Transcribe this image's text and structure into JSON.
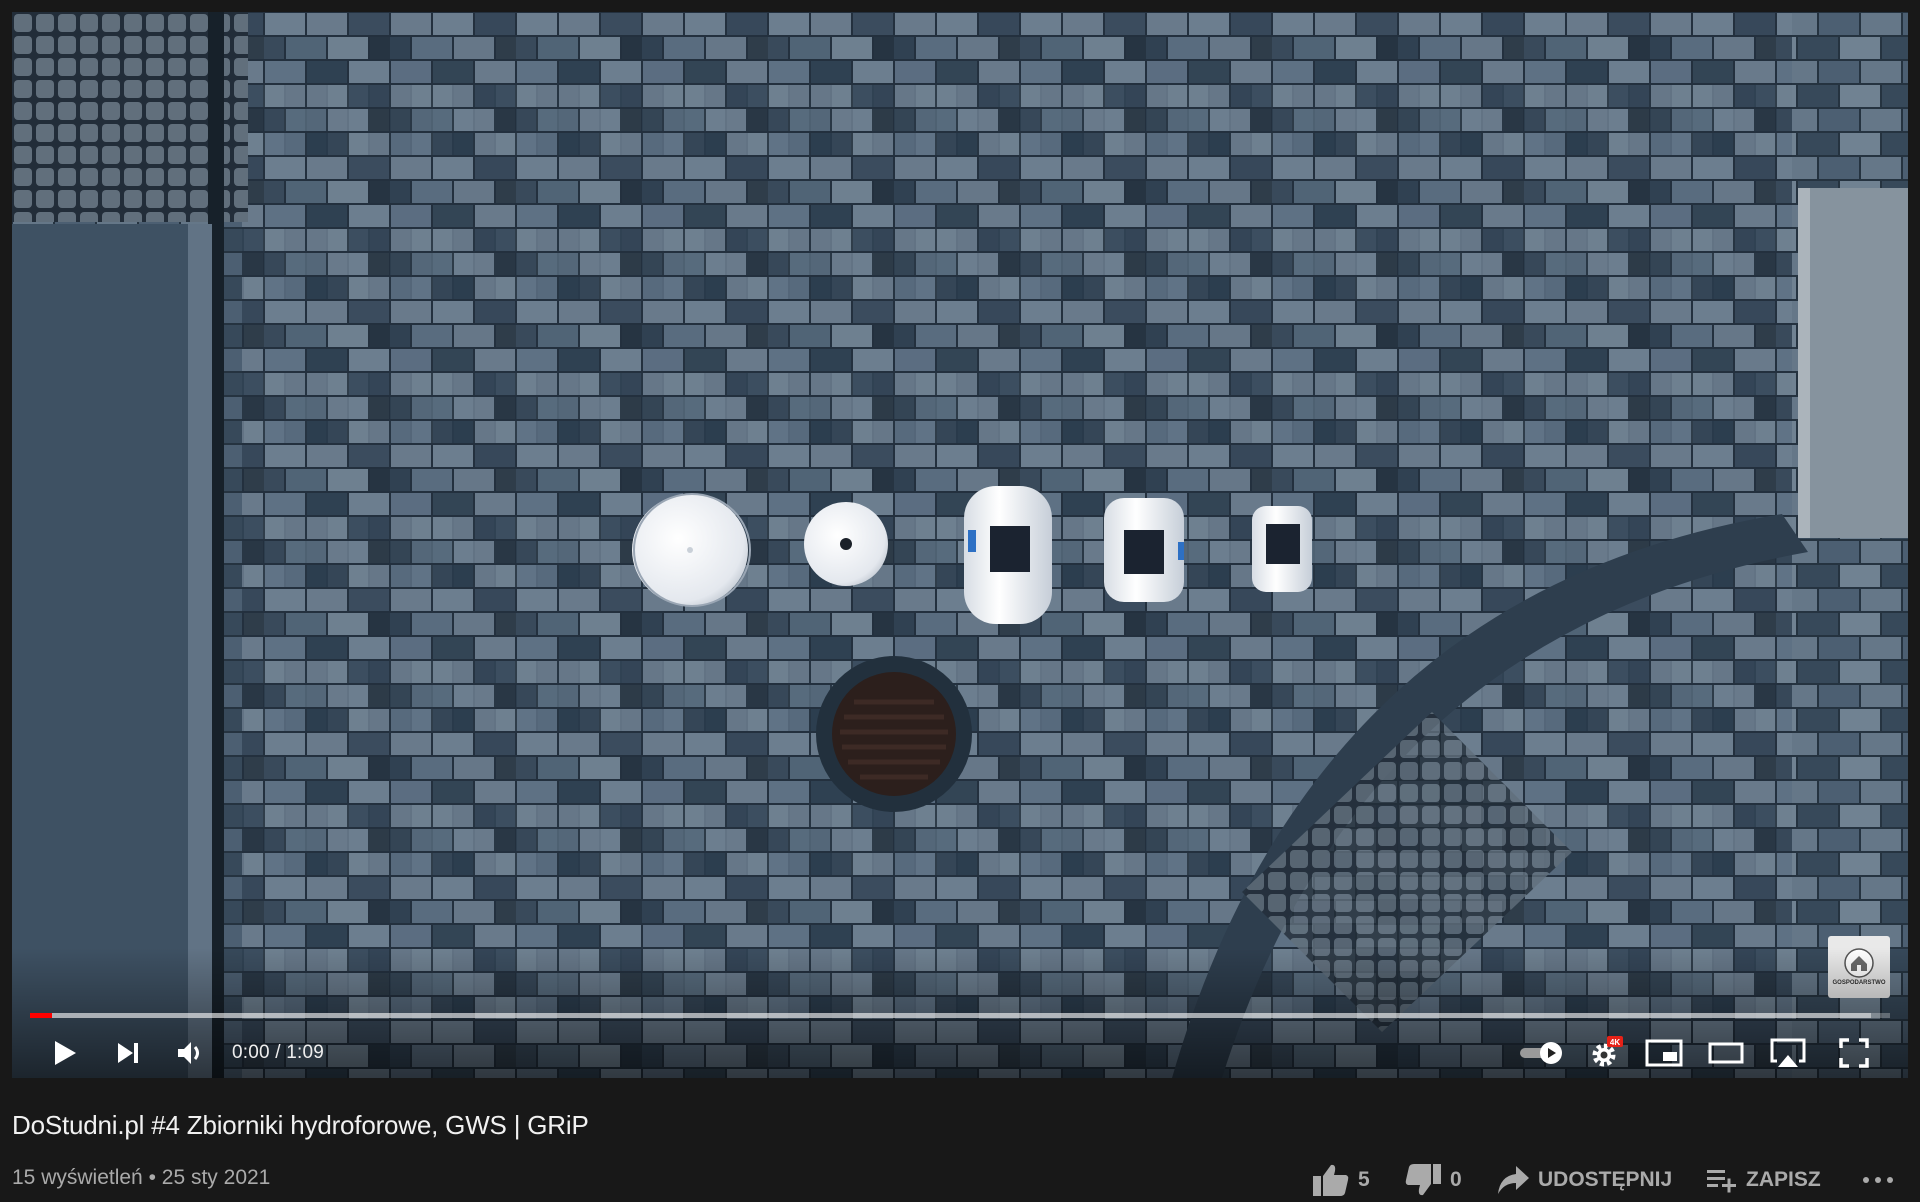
{
  "player": {
    "time_current": "0:00",
    "time_total": "1:09",
    "time_display": "0:00 / 1:09",
    "progress_played": 0.012,
    "progress_loaded": 0.99,
    "settings_badge": "4K",
    "watermark_text": "GOSPODARSTWO"
  },
  "video": {
    "title": "DoStudni.pl #4 Zbiorniki hydroforowe, GWS | GRiP",
    "views": "15 wyświetleń",
    "separator": "•",
    "date": "25 sty 2021",
    "likes": "5",
    "dislikes": "0",
    "share_label": "UDOSTĘPNIJ",
    "save_label": "ZAPISZ"
  },
  "colors": {
    "page_bg": "#181818",
    "progress_red": "#ff0000",
    "muted_text": "#aaaaaa"
  }
}
